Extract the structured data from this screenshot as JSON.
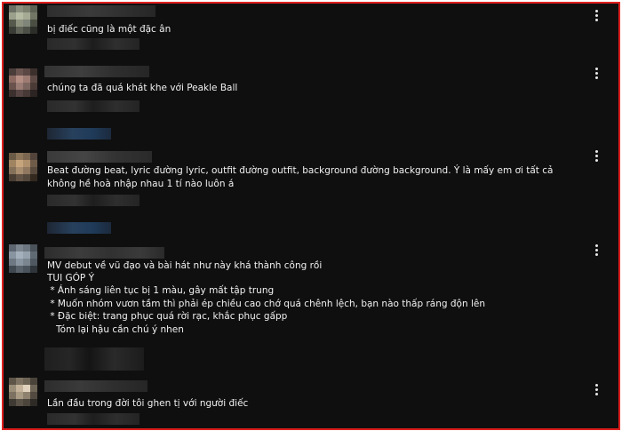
{
  "comments": [
    {
      "text": "bị điếc cũng là một đặc ân",
      "menu_icon": "more-vertical-icon"
    },
    {
      "text": "chúng ta đã quá khát khe với Peakle Ball",
      "menu_icon": "more-vertical-icon"
    },
    {
      "text": "Beat đường beat, lyric đường lyric, outfit đường outfit, background đường background. Ý là mấy em ơi tất cả không hề hoà nhập nhau 1 tí nào luôn á",
      "menu_icon": "more-vertical-icon"
    },
    {
      "lines": [
        "MV debut về vũ đạo và bài hát như này khá thành công rồi",
        "TUI GÓP Ý",
        " * Ánh sáng liên tục bị 1 màu, gây mất tập trung",
        " * Muốn nhóm vươn tầm thì phải ép chiều cao chớ quá chênh lệch, bạn nào thấp ráng độn lên",
        " * Đặc biệt: trang phục quá rời rạc, khắc phục gấpp",
        "   Tóm lại hậu cần chú ý nhen"
      ],
      "menu_icon": "more-vertical-icon"
    },
    {
      "text": "Lần đầu trong đời tôi ghen tị với người điếc",
      "menu_icon": "more-vertical-icon"
    }
  ],
  "colors": {
    "background": "#0f0f0f",
    "text": "#f1f1f1",
    "frame_border": "#e02020"
  }
}
